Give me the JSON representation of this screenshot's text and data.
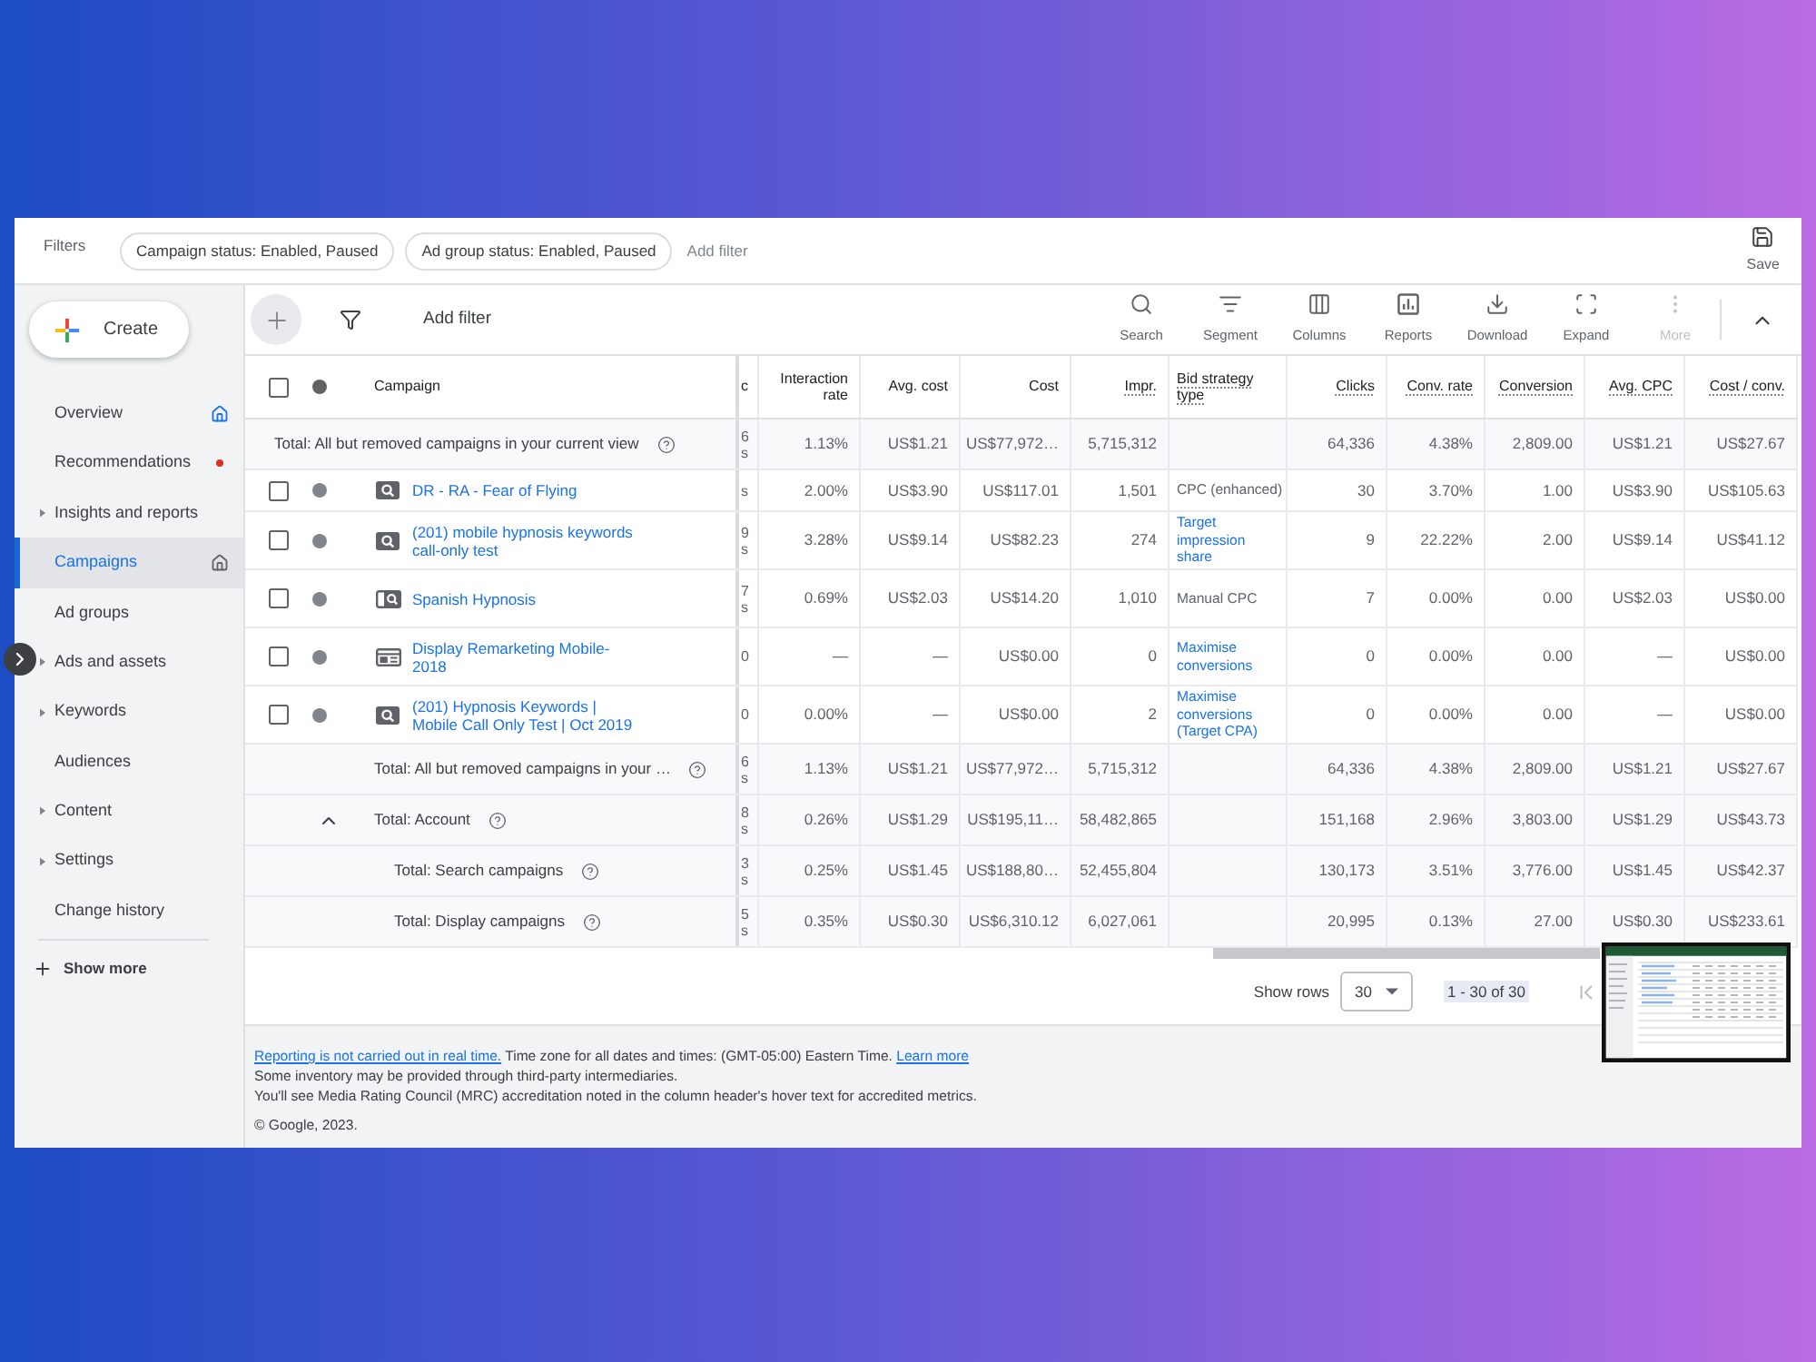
{
  "filters": {
    "label": "Filters",
    "chips": [
      "Campaign status: Enabled, Paused",
      "Ad group status: Enabled, Paused"
    ],
    "add_filter": "Add filter",
    "save": "Save"
  },
  "sidebar": {
    "create": "Create",
    "items": [
      {
        "label": "Overview",
        "selected": false,
        "expandable": false,
        "marker": {
          "kind": "home",
          "color": "#1a73e8"
        }
      },
      {
        "label": "Recommendations",
        "selected": false,
        "expandable": false,
        "marker": {
          "kind": "dot",
          "color": "#d93025"
        }
      },
      {
        "label": "Insights and reports",
        "selected": false,
        "expandable": true
      },
      {
        "label": "Campaigns",
        "selected": true,
        "expandable": false,
        "marker": {
          "kind": "home",
          "color": "#5f6368"
        }
      },
      {
        "label": "Ad groups",
        "selected": false,
        "expandable": false
      },
      {
        "label": "Ads and assets",
        "selected": false,
        "expandable": true
      },
      {
        "label": "Keywords",
        "selected": false,
        "expandable": true
      },
      {
        "label": "Audiences",
        "selected": false,
        "expandable": false
      },
      {
        "label": "Content",
        "selected": false,
        "expandable": true
      },
      {
        "label": "Settings",
        "selected": false,
        "expandable": true
      },
      {
        "label": "Change history",
        "selected": false,
        "expandable": false
      }
    ],
    "show_more": "Show more"
  },
  "toolbar": {
    "add_filter": "Add filter",
    "actions": [
      {
        "kind": "search",
        "label": "Search",
        "disabled": false
      },
      {
        "kind": "segment",
        "label": "Segment",
        "disabled": false
      },
      {
        "kind": "columns",
        "label": "Columns",
        "disabled": false
      },
      {
        "kind": "reports",
        "label": "Reports",
        "disabled": false
      },
      {
        "kind": "download",
        "label": "Download",
        "disabled": false
      },
      {
        "kind": "expand",
        "label": "Expand",
        "disabled": false
      },
      {
        "kind": "more",
        "label": "More",
        "disabled": true
      }
    ]
  },
  "table": {
    "select_all_checked": false,
    "campaign_column": {
      "label": "Campaign",
      "underlined": false
    },
    "columns": [
      {
        "kind": "fragment",
        "label": "c",
        "underlined": false
      },
      {
        "kind": "metric",
        "label": "Interaction rate",
        "underlined": false
      },
      {
        "kind": "metric",
        "label": "Avg. cost",
        "underlined": false
      },
      {
        "kind": "metric",
        "label": "Cost",
        "underlined": false
      },
      {
        "kind": "metric",
        "label": "Impr.",
        "underlined": true
      },
      {
        "kind": "strategy",
        "label": "Bid strategy type",
        "underlined": true
      },
      {
        "kind": "metric",
        "label": "Clicks",
        "underlined": true
      },
      {
        "kind": "metric",
        "label": "Conv. rate",
        "underlined": true
      },
      {
        "kind": "metric",
        "label": "Conversion",
        "underlined": true
      },
      {
        "kind": "metric",
        "label": "Avg. CPC",
        "underlined": true
      },
      {
        "kind": "metric",
        "label": "Cost / conv.",
        "underlined": true
      }
    ],
    "pinned_total": {
      "label": "Total: All but removed campaigns in your current view",
      "cells": [
        "6\ns",
        "1.13%",
        "US$1.21",
        "US$77,972…",
        "5,715,312",
        null,
        "64,336",
        "4.38%",
        "2,809.00",
        "US$1.21",
        "US$27.67"
      ]
    },
    "rows": [
      {
        "name": "DR - RA - Fear of Flying",
        "kind": "search",
        "paused": true,
        "checked": false,
        "strategy_link": false,
        "cells": [
          "s",
          "2.00%",
          "US$3.90",
          "US$117.01",
          "1,501",
          "CPC (enhanced)",
          "30",
          "3.70%",
          "1.00",
          "US$3.90",
          "US$105.63"
        ]
      },
      {
        "name": "(201) mobile hypnosis keywords call-only test",
        "kind": "search",
        "paused": true,
        "checked": false,
        "strategy_link": true,
        "cells": [
          "9\ns",
          "3.28%",
          "US$9.14",
          "US$82.23",
          "274",
          "Target impression share",
          "9",
          "22.22%",
          "2.00",
          "US$9.14",
          "US$41.12"
        ]
      },
      {
        "name": "Spanish Hypnosis",
        "kind": "search_panel",
        "paused": true,
        "checked": false,
        "strategy_link": false,
        "cells": [
          "7\ns",
          "0.69%",
          "US$2.03",
          "US$14.20",
          "1,010",
          "Manual CPC",
          "7",
          "0.00%",
          "0.00",
          "US$2.03",
          "US$0.00"
        ]
      },
      {
        "name": "Display Remarketing Mobile-2018",
        "kind": "display",
        "paused": true,
        "checked": false,
        "strategy_link": true,
        "cells": [
          "0",
          "—",
          "—",
          "US$0.00",
          "0",
          "Maximise conversions",
          "0",
          "0.00%",
          "0.00",
          "—",
          "US$0.00"
        ]
      },
      {
        "name": "(201) Hypnosis Keywords | Mobile Call Only Test | Oct 2019",
        "kind": "search",
        "paused": true,
        "checked": false,
        "strategy_link": true,
        "cells": [
          "0",
          "0.00%",
          "—",
          "US$0.00",
          "2",
          "Maximise conversions (Target CPA)",
          "0",
          "0.00%",
          "0.00",
          "—",
          "US$0.00"
        ]
      }
    ],
    "totals": [
      {
        "label": "Total: All but removed campaigns in your …",
        "cells": [
          "6\ns",
          "1.13%",
          "US$1.21",
          "US$77,972…",
          "5,715,312",
          null,
          "64,336",
          "4.38%",
          "2,809.00",
          "US$1.21",
          "US$27.67"
        ]
      },
      {
        "label": "Total: Account",
        "expanded": true,
        "cells": [
          "8\ns",
          "0.26%",
          "US$1.29",
          "US$195,11…",
          "58,482,865",
          null,
          "151,168",
          "2.96%",
          "3,803.00",
          "US$1.29",
          "US$43.73"
        ],
        "children": [
          {
            "label": "Total: Search campaigns",
            "cells": [
              "3\ns",
              "0.25%",
              "US$1.45",
              "US$188,80…",
              "52,455,804",
              null,
              "130,173",
              "3.51%",
              "3,776.00",
              "US$1.45",
              "US$42.37"
            ]
          },
          {
            "label": "Total: Display campaigns",
            "cells": [
              "5\ns",
              "0.35%",
              "US$0.30",
              "US$6,310.12",
              "6,027,061",
              null,
              "20,995",
              "0.13%",
              "27.00",
              "US$0.30",
              "US$233.61"
            ]
          }
        ]
      }
    ]
  },
  "pagination": {
    "label": "Show rows",
    "rows": "30",
    "range": "1 - 30 of 30"
  },
  "footer": {
    "notice": {
      "link": "Reporting is not carried out in real time.",
      "text": "Time zone for all dates and times: (GMT-05:00) Eastern Time.",
      "learn_more": "Learn more"
    },
    "lines": [
      "Some inventory may be provided through third-party intermediaries.",
      "You'll see Media Rating Council (MRC) accreditation noted in the column header's hover text for accredited metrics."
    ],
    "copyright": "© Google, 2023."
  }
}
